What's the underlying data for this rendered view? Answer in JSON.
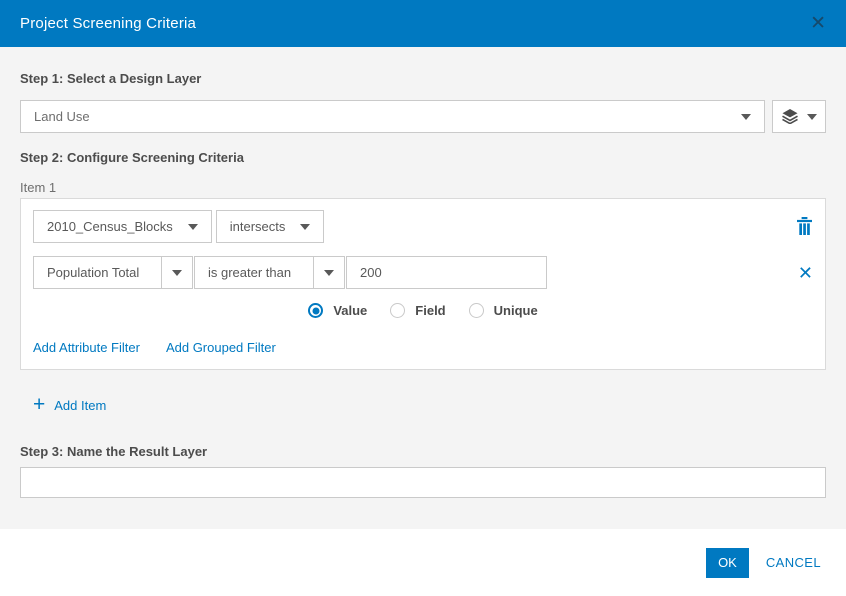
{
  "dialog": {
    "title": "Project Screening Criteria",
    "close_icon": "✕"
  },
  "step1": {
    "label": "Step 1: Select a Design Layer",
    "selected_layer": "Land Use"
  },
  "step2": {
    "label": "Step 2: Configure Screening Criteria",
    "item_label": "Item 1",
    "expression": {
      "layer": "2010_Census_Blocks",
      "operator": "intersects"
    },
    "attribute_filter": {
      "field": "Population Total",
      "operator": "is greater than",
      "value": "200"
    },
    "value_type_options": [
      {
        "label": "Value",
        "selected": true
      },
      {
        "label": "Field",
        "selected": false
      },
      {
        "label": "Unique",
        "selected": false
      }
    ],
    "add_attribute_filter_label": "Add Attribute Filter",
    "add_grouped_filter_label": "Add Grouped Filter",
    "add_item_plus": "+",
    "add_item_label": "Add Item",
    "remove_filter_icon": "✕"
  },
  "step3": {
    "label": "Step 3: Name the Result Layer",
    "value": ""
  },
  "footer": {
    "ok_label": "OK",
    "cancel_label": "CANCEL"
  },
  "colors": {
    "accent": "#0079c1",
    "header_bg": "#0079c1",
    "body_bg": "#f4f4f4",
    "label_text": "#4c4c4c",
    "muted_text": "#6e6e6e",
    "border": "#cacaca"
  }
}
